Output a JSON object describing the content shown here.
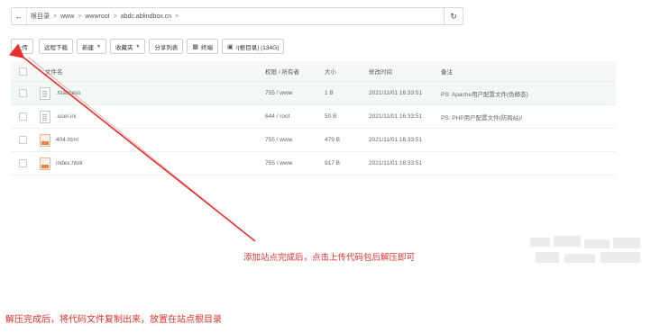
{
  "breadcrumb": {
    "segments": [
      "根目录",
      "www",
      "wwwroot",
      "abdc.ablindbox.cn"
    ]
  },
  "toolbar": {
    "upload": "上传",
    "remote_download": "远程下载",
    "new": "新建",
    "favorites": "收藏夹",
    "share_list": "分享列表",
    "terminal": "终端",
    "disk": "/(根目录) (134G)"
  },
  "table": {
    "headers": {
      "name": "文件名",
      "perm": "权限 / 所有者",
      "size": "大小",
      "mtime": "修改时间",
      "note": "备注"
    },
    "rows": [
      {
        "name": ".htaccess",
        "perm": "755 / www",
        "size": "1 B",
        "mtime": "2021/11/01 16:33:51",
        "note": "PS: Apache用户配置文件(伪静态)",
        "icon": "doc"
      },
      {
        "name": ".user.ini",
        "perm": "644 / root",
        "size": "50 B",
        "mtime": "2021/11/01 16:33:51",
        "note": "PS: PHP用户配置文件(防跨站)!",
        "icon": "doc"
      },
      {
        "name": "404.html",
        "perm": "755 / www",
        "size": "479 B",
        "mtime": "2021/11/01 16:33:51",
        "note": "",
        "icon": "html"
      },
      {
        "name": "index.html",
        "perm": "755 / www",
        "size": "917 B",
        "mtime": "2021/11/01 16:33:51",
        "note": "",
        "icon": "html"
      }
    ]
  },
  "annotations": {
    "upload_hint": "添加站点完成后，点击上传代码包后解压即可",
    "footer_note": "解压完成后，将代码文件复制出来，放置在站点根目录"
  },
  "colors": {
    "annotation_red": "#e5302c",
    "highlight_row": "#f2f9f4"
  }
}
